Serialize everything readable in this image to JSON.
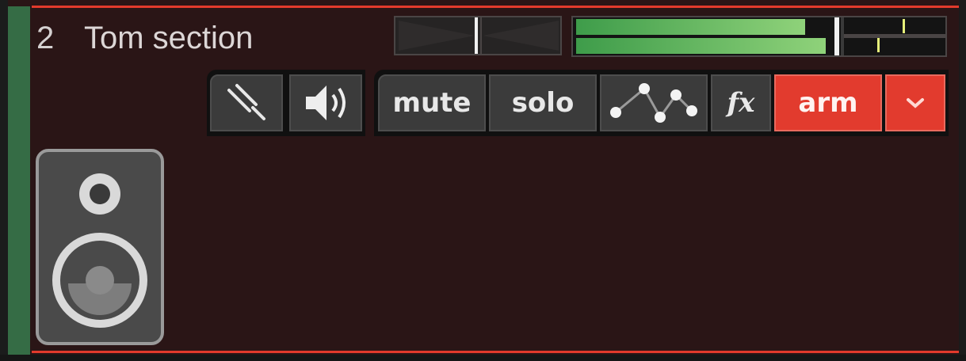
{
  "track": {
    "number": "2",
    "name": "Tom section",
    "colors": {
      "strip": "#356c45",
      "border": "#e23a2c",
      "background": "#2a1516",
      "arm": "#e23b2e"
    }
  },
  "fader": {
    "pan_icon": "pan-fader",
    "volume_icon": "volume-fader"
  },
  "meters": {
    "left_level": 0.91,
    "right_level": 0.99
  },
  "buttons": {
    "monitor_input_icon": "tuning-fork-icon",
    "output_icon": "speaker-icon",
    "mute": "mute",
    "solo": "solo",
    "automation_icon": "automation-icon",
    "fx": "fx",
    "arm": "arm",
    "menu_icon": "chevron-down-icon"
  },
  "track_icon": "speaker-icon"
}
